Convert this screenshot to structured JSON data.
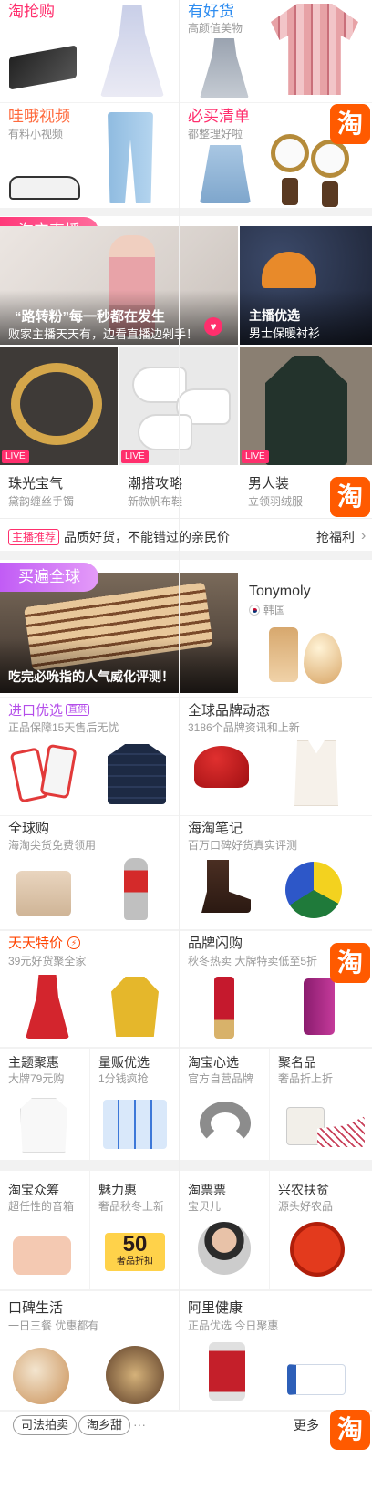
{
  "top": {
    "cells": [
      {
        "title": "淘抢购",
        "sub": "",
        "color": "#ff2f6d"
      },
      {
        "title": "有好货",
        "sub": "高颜值美物",
        "color": "#2d8cf0"
      },
      {
        "title": "哇哦视频",
        "sub": "有料小视频",
        "color": "#ff6a3d"
      },
      {
        "title": "必买清单",
        "sub": "都整理好啦",
        "color": "#ff2f6d"
      }
    ]
  },
  "tao_badge": "淘",
  "live": {
    "header": "淘宝直播",
    "banner_title": "“路转粉”每一秒都在发生",
    "banner_sub": "败家主播天天有，边看直播边剁手！",
    "side_title": "主播优选",
    "side_sub": "男士保暖衬衫",
    "live_tag": "LIVE",
    "items": [
      {
        "title": "珠光宝气",
        "sub": "黛韵缠丝手镯"
      },
      {
        "title": "潮搭攻略",
        "sub": "新款帆布鞋"
      },
      {
        "title": "男人装",
        "sub": "立领羽绒服"
      }
    ],
    "promo_tag": "主播推荐",
    "promo_text": "品质好货，不能错过的亲民价",
    "promo_link": "抢福利",
    "promo_arrow": "›"
  },
  "global": {
    "header": "买遍全球",
    "banner_text": "吃完必吮指的人气威化评测！",
    "brand": "Tonymoly",
    "country": "韩国",
    "cells": [
      {
        "title": "进口优选",
        "badge": "直供",
        "sub": "正品保障15天售后无忧",
        "color": "#b44dea"
      },
      {
        "title": "全球品牌动态",
        "sub": "3186个品牌资讯和上新",
        "color": "#333"
      },
      {
        "title": "全球购",
        "sub": "海淘尖货免费领用",
        "color": "#333"
      },
      {
        "title": "海淘笔记",
        "sub": "百万口碑好货真实评测",
        "color": "#333"
      }
    ]
  },
  "deals": {
    "cells": [
      {
        "title": "天天特价",
        "sub": "39元好货聚全家",
        "color": "#ff4400"
      },
      {
        "title": "品牌闪购",
        "sub": "秋冬热卖 大牌特卖低至5折",
        "color": "#333"
      }
    ],
    "small": [
      {
        "title": "主题聚惠",
        "sub": "大牌79元购"
      },
      {
        "title": "量贩优选",
        "sub": "1分钱疯抢"
      },
      {
        "title": "淘宝心选",
        "sub": "官方自营品牌"
      },
      {
        "title": "聚名品",
        "sub": "奢品折上折"
      }
    ]
  },
  "more": {
    "small": [
      {
        "title": "淘宝众筹",
        "sub": "超任性的音箱"
      },
      {
        "title": "魅力惠",
        "sub": "奢品秋冬上新"
      },
      {
        "title": "淘票票",
        "sub": "宝贝儿"
      },
      {
        "title": "兴农扶贫",
        "sub": "源头好农品"
      }
    ],
    "coupon_value": "50",
    "coupon_text": "奢品折扣",
    "bottom": [
      {
        "title": "口碑生活",
        "sub": "一日三餐 优惠都有"
      },
      {
        "title": "阿里健康",
        "sub": "正品优选 今日聚惠"
      }
    ]
  },
  "footer": {
    "chips": [
      "司法拍卖",
      "淘乡甜"
    ],
    "dots": "···",
    "more": "更多"
  }
}
